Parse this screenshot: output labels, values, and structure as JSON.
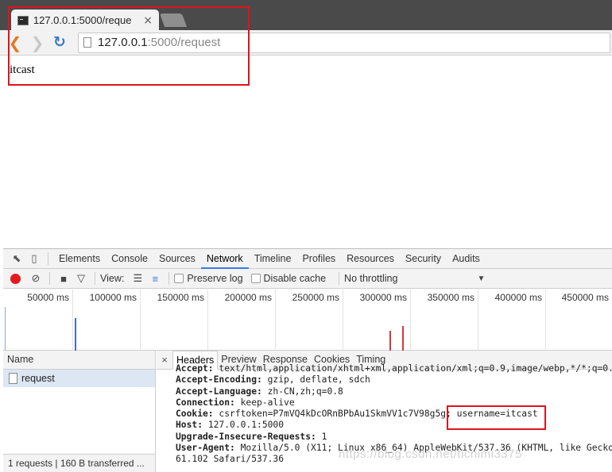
{
  "browser": {
    "tab_title": "127.0.0.1:5000/reque",
    "tab_close": "×",
    "url_host": "127.0.0.1",
    "url_path": ":5000/request"
  },
  "page": {
    "body_text": "itcast"
  },
  "devtools": {
    "panels": [
      "Elements",
      "Console",
      "Sources",
      "Network",
      "Timeline",
      "Profiles",
      "Resources",
      "Security",
      "Audits"
    ],
    "active_panel": "Network",
    "toolbar": {
      "view_label": "View:",
      "preserve_log": "Preserve log",
      "disable_cache": "Disable cache",
      "throttling": "No throttling"
    },
    "timeline_ticks": [
      "50000 ms",
      "100000 ms",
      "150000 ms",
      "200000 ms",
      "250000 ms",
      "300000 ms",
      "350000 ms",
      "400000 ms",
      "450000 ms"
    ],
    "request_list": {
      "column": "Name",
      "rows": [
        "request"
      ],
      "status": "1 requests  |  160 B transferred ..."
    },
    "detail": {
      "close": "×",
      "tabs": [
        "Headers",
        "Preview",
        "Response",
        "Cookies",
        "Timing"
      ],
      "active_tab": "Headers",
      "headers": [
        {
          "key": "Accept:",
          "value": " text/html,application/xhtml+xml,application/xml;q=0.9,image/webp,*/*;q=0."
        },
        {
          "key": "Accept-Encoding:",
          "value": " gzip, deflate, sdch"
        },
        {
          "key": "Accept-Language:",
          "value": " zh-CN,zh;q=0.8"
        },
        {
          "key": "Connection:",
          "value": " keep-alive"
        },
        {
          "key": "Cookie:",
          "value": " csrftoken=P7mVQ4kDcORnBPbAu1SkmVV1c7V98g5g; username=itcast"
        },
        {
          "key": "Host:",
          "value": " 127.0.0.1:5000"
        },
        {
          "key": "Upgrade-Insecure-Requests:",
          "value": " 1"
        },
        {
          "key": "User-Agent:",
          "value": " Mozilla/5.0 (X11; Linux x86_64) AppleWebKit/537.36 (KHTML, like Gecko"
        },
        {
          "key": "",
          "value": "61.102 Safari/537.36"
        }
      ]
    }
  },
  "watermark": "https://blog.csdn.net/tichimi3375",
  "colors": {
    "highlight": "#e0131a",
    "record": "#e21c1c",
    "active_tab_underline": "#3b7ddd",
    "selected_row": "#dde6f3"
  }
}
